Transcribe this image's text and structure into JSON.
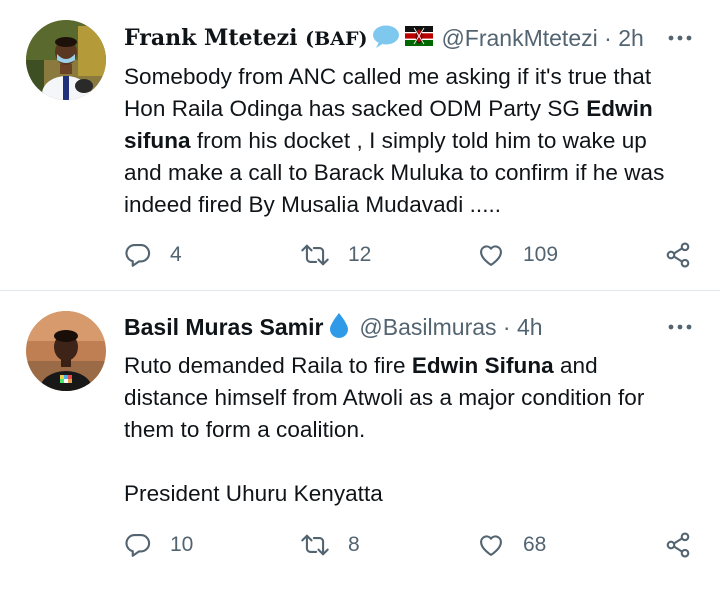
{
  "tweets": [
    {
      "display_name": "Frank Mtetezi",
      "display_name_suffix": "(BAF)",
      "handle": "@FrankMtetezi",
      "time": "2h",
      "badges": [
        "speech-bubble-emoji",
        "kenya-flag-emoji"
      ],
      "text_segments": [
        {
          "text": "Somebody from ANC called me asking if it's true that",
          "bold": false
        },
        {
          "text": "Hon Raila  Odinga has sacked ODM Party SG ",
          "bold": false
        },
        {
          "text": "Edwin",
          "bold": true
        },
        {
          "text": "sifuna",
          "bold": true
        },
        {
          "text": " from  his docket , I simply told him to wake up",
          "bold": false
        },
        {
          "text": "and make a call to Barack Muluka to confirm if he was",
          "bold": false
        },
        {
          "text": "indeed fired By Musalia Mudavadi .....",
          "bold": false
        }
      ],
      "replies": "4",
      "retweets": "12",
      "likes": "109"
    },
    {
      "display_name": "Basil Muras Samir",
      "handle": "@Basilmuras",
      "time": "4h",
      "badges": [
        "droplet-emoji"
      ],
      "text_segments": [
        {
          "text": "Ruto demanded Raila to fire ",
          "bold": false
        },
        {
          "text": "Edwin Sifuna",
          "bold": true
        },
        {
          "text": " and",
          "bold": false
        },
        {
          "text": "distance himself from Atwoli as a major condition for",
          "bold": false
        },
        {
          "text": "them  to form a coalition.",
          "bold": false
        },
        {
          "text": "President Uhuru Kenyatta",
          "bold": false
        }
      ],
      "replies": "10",
      "retweets": "8",
      "likes": "68"
    }
  ],
  "colors": {
    "text_primary": "#0f1419",
    "text_secondary": "#536471",
    "divider": "#e1e8ed",
    "bubble_emoji": "#7ec8f0",
    "droplet_emoji": "#2f9be8"
  }
}
